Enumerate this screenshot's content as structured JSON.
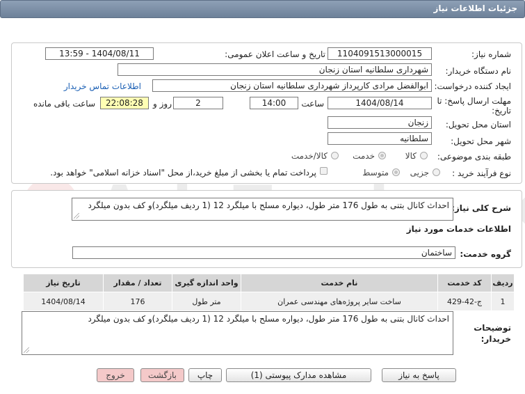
{
  "header": {
    "title": "جزئیات اطلاعات نیاز"
  },
  "fields": {
    "need_number_label": "شماره نیاز:",
    "need_number": "1104091513000015",
    "announce_label": "تاریخ و ساعت اعلان عمومی:",
    "announce_value": "1404/08/11 - 13:59",
    "buyer_org_label": "نام دستگاه خریدار:",
    "buyer_org": "شهرداری سلطانیه استان زنجان",
    "requester_label": "ایجاد کننده درخواست:",
    "requester": "ابوالفضل مرادی کارپرداز شهرداری سلطانیه استان زنجان",
    "contact_link": "اطلاعات تماس خریدار",
    "deadline_label_1": "مهلت ارسال پاسخ: تا",
    "deadline_label_2": "تاریخ:",
    "deadline_date": "1404/08/14",
    "time_label": "ساعت",
    "deadline_time": "14:00",
    "days_value": "2",
    "days_label": "روز و",
    "remaining_time": "22:08:28",
    "remaining_label": "ساعت باقی مانده",
    "province_label": "استان محل تحویل:",
    "province": "زنجان",
    "city_label": "شهر محل تحویل:",
    "city": "سلطانیه",
    "category_label": "طبقه بندی موضوعی:",
    "category_options": [
      "کالا",
      "خدمت",
      "کالا/خدمت"
    ],
    "purchase_type_label": "نوع فرآیند خرید :",
    "purchase_type_options": [
      "جزیی",
      "متوسط"
    ],
    "payment_note": "پرداخت تمام یا بخشی از مبلغ خرید،از محل \"اسناد خزانه اسلامی\" خواهد بود."
  },
  "description": {
    "label": "شرح کلی نیاز:",
    "text": "احداث کانال بتنی به طول 176 متر طول، دیواره مسلح با میلگرد 12 (1 ردیف میلگرد)و کف بدون میلگرد"
  },
  "services": {
    "section_title": "اطلاعات خدمات مورد نیاز",
    "group_label": "گروه خدمت:",
    "group_value": "ساختمان"
  },
  "table": {
    "headers": [
      "ردیف",
      "کد خدمت",
      "نام خدمت",
      "واحد اندازه گیری",
      "تعداد / مقدار",
      "تاریخ نیاز"
    ],
    "rows": [
      [
        "1",
        "ج-42-429",
        "ساخت سایر پروژه‌های مهندسی عمران",
        "متر طول",
        "176",
        "1404/08/14"
      ]
    ]
  },
  "buyer_notes": {
    "label_1": "توضیحات",
    "label_2": "خریدار:",
    "text": "احداث کانال بتنی به طول 176 متر طول، دیواره مسلح با میلگرد 12 (1 ردیف میلگرد)و کف بدون میلگرد"
  },
  "buttons": {
    "reply": "پاسخ به نیاز",
    "docs": "مشاهده مدارک پیوستی (1)",
    "print": "چاپ",
    "back": "بازگشت",
    "exit": "خروج"
  }
}
